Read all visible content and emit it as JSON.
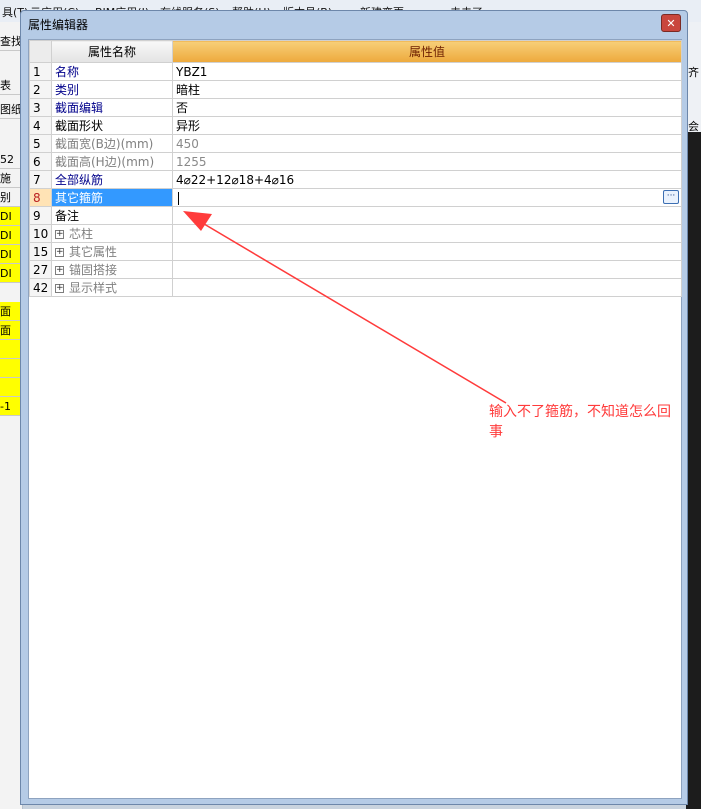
{
  "background_app": {
    "menu_fragments": [
      "具(T)",
      "云应用(C)",
      "BIM应用(I)",
      "在线服务(S)",
      "帮助(H)",
      "版本号(B)",
      "新建变更",
      "去去了"
    ],
    "left_fragments": [
      "查找",
      "表",
      "图纸",
      "52",
      "施",
      "别",
      "DI",
      "DI",
      "DI",
      "DI",
      "面",
      "面",
      "-1"
    ],
    "right_fragments": [
      "齐",
      "会"
    ]
  },
  "dialog": {
    "title": "属性编辑器",
    "close_label": "✕",
    "grid": {
      "headers": {
        "index": "",
        "name": "属性名称",
        "value": "属性值"
      },
      "rows": [
        {
          "index": "1",
          "name": "名称",
          "value": "YBZ1",
          "style": "blue"
        },
        {
          "index": "2",
          "name": "类别",
          "value": "暗柱",
          "style": "blue"
        },
        {
          "index": "3",
          "name": "截面编辑",
          "value": "否",
          "style": "blue"
        },
        {
          "index": "4",
          "name": "截面形状",
          "value": "异形",
          "style": "black"
        },
        {
          "index": "5",
          "name": "截面宽(B边)(mm)",
          "value": "450",
          "style": "gray"
        },
        {
          "index": "6",
          "name": "截面高(H边)(mm)",
          "value": "1255",
          "style": "gray"
        },
        {
          "index": "7",
          "name": "全部纵筋",
          "value": "4⌀22+12⌀18+4⌀16",
          "style": "blue"
        },
        {
          "index": "8",
          "name": "其它箍筋",
          "value": "",
          "style": "selected"
        },
        {
          "index": "9",
          "name": "备注",
          "value": "",
          "style": "black"
        },
        {
          "index": "10",
          "name": "芯柱",
          "value": "",
          "style": "group"
        },
        {
          "index": "15",
          "name": "其它属性",
          "value": "",
          "style": "group"
        },
        {
          "index": "27",
          "name": "锚固搭接",
          "value": "",
          "style": "group"
        },
        {
          "index": "42",
          "name": "显示样式",
          "value": "",
          "style": "group"
        }
      ],
      "expander_symbol": "+",
      "ellipsis_label": "···"
    }
  },
  "annotation": {
    "text": "输入不了箍筋，不知道怎么回事",
    "color": "#ff3b3b"
  },
  "colors": {
    "value_header": "#eda93c",
    "selected_row": "#3399ff",
    "property_blue": "#00008b"
  }
}
